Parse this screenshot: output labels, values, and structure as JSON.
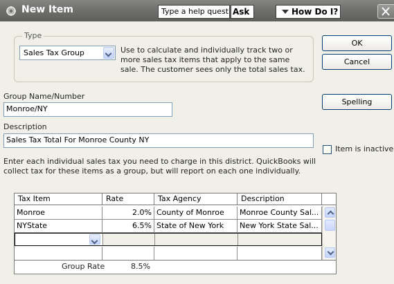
{
  "window": {
    "title": "New Item",
    "help_placeholder": "Type a help question",
    "ask_label": "Ask",
    "how_do_i_label": "How Do I?"
  },
  "type_group": {
    "legend": "Type",
    "selected": "Sales Tax Group",
    "description": "Use to calculate and individually track two or more sales tax items that apply to the same sale. The customer sees only the total sales tax."
  },
  "buttons": {
    "ok": "OK",
    "cancel": "Cancel",
    "spelling": "Spelling"
  },
  "form": {
    "group_name_label": "Group Name/Number",
    "group_name_value": "Monroe/NY",
    "description_label": "Description",
    "description_value": "Sales Tax Total For Monroe County NY",
    "inactive_label": "Item is inactive",
    "info_text": "Enter each individual sales tax you need to charge in this district.  QuickBooks will collect tax for these items as a group, but will report on each one individually."
  },
  "table": {
    "columns": [
      "Tax Item",
      "Rate",
      "Tax Agency",
      "Description"
    ],
    "rows": [
      {
        "tax_item": "Monroe",
        "rate": "2.0%",
        "tax_agency": "County of Monroe",
        "description": "Monroe County Sal..."
      },
      {
        "tax_item": "NYState",
        "rate": "6.5%",
        "tax_agency": "State of New York",
        "description": "New York State Sal..."
      }
    ],
    "group_rate_label": "Group Rate",
    "group_rate_value": "8.5%"
  },
  "icons": {
    "title": "new-item-icon",
    "close": "close-icon"
  }
}
